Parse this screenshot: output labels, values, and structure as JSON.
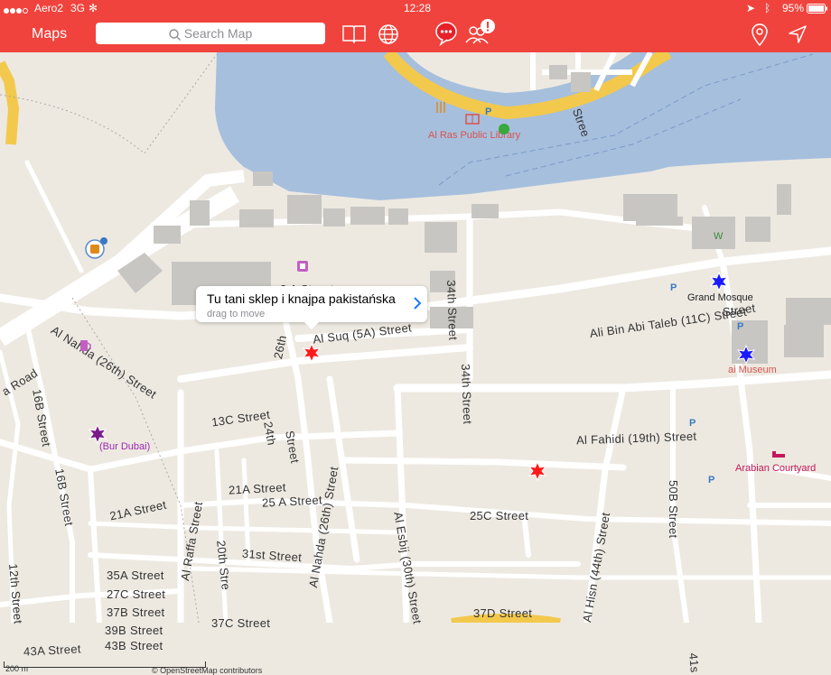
{
  "status": {
    "carrier": "Aero2",
    "network": "3G",
    "time": "12:28",
    "battery": "95%"
  },
  "toolbar": {
    "maps_label": "Maps",
    "search_placeholder": "Search Map"
  },
  "callout": {
    "title": "Tu tani sklep i knajpa pakistańska",
    "subtitle": "drag to move"
  },
  "streets": {
    "s1": "Al Nahda (26th) Street",
    "s2": "Al Suq (5A) Street",
    "s3": "26th",
    "s4": "34th Street",
    "s5": "34th Street",
    "s6": "Ali Bin Abi Taleb (11C) Street",
    "s7": "13C Street",
    "s8": "24th",
    "s9": "Street",
    "s10": "Al Fahidi (19th) Street",
    "s11": "21A Street",
    "s12": "25 A Street",
    "s13": "21A Street",
    "s14": "Al Nahda (26th) Street",
    "s15": "Al Esbij (30th) Street",
    "s16": "25C Street",
    "s17": "Al Raffa Street",
    "s18": "20th Stre",
    "s19": "31st Street",
    "s20": "35A Street",
    "s21": "27C Street",
    "s22": "37B Street",
    "s23": "39B Street",
    "s24": "43B Street",
    "s25": "37C Street",
    "s26": "37D Street",
    "s27": "Al Hisn (44th) Street",
    "s28": "50B Street",
    "s29": "16B Street",
    "s30": "16B Street",
    "s31": "12th Street",
    "s32": "43A Street",
    "s33": "3 A Street",
    "s34": "a Road",
    "s35": "41s",
    "s36": "Stree",
    "s37": "Street"
  },
  "pois": {
    "library": "Al Ras Public Library",
    "mosque": "Grand Mosque",
    "museum": "ai Museum",
    "courtyard": "Arabian Courtyard",
    "bur_dubai": "(Bur Dubai)",
    "w_mark": "W"
  },
  "map_footer": {
    "scale": "200 m",
    "attribution": "© OpenStreetMap contributors"
  },
  "colors": {
    "bar": "#f0433d",
    "water": "#a5bfdd",
    "road": "#ffffff",
    "land": "#ede9e1",
    "building": "#c8c6c2",
    "pin_red": "#ff1a1a",
    "pin_blue": "#1a1aff",
    "pin_purple": "#7a1a8a"
  }
}
